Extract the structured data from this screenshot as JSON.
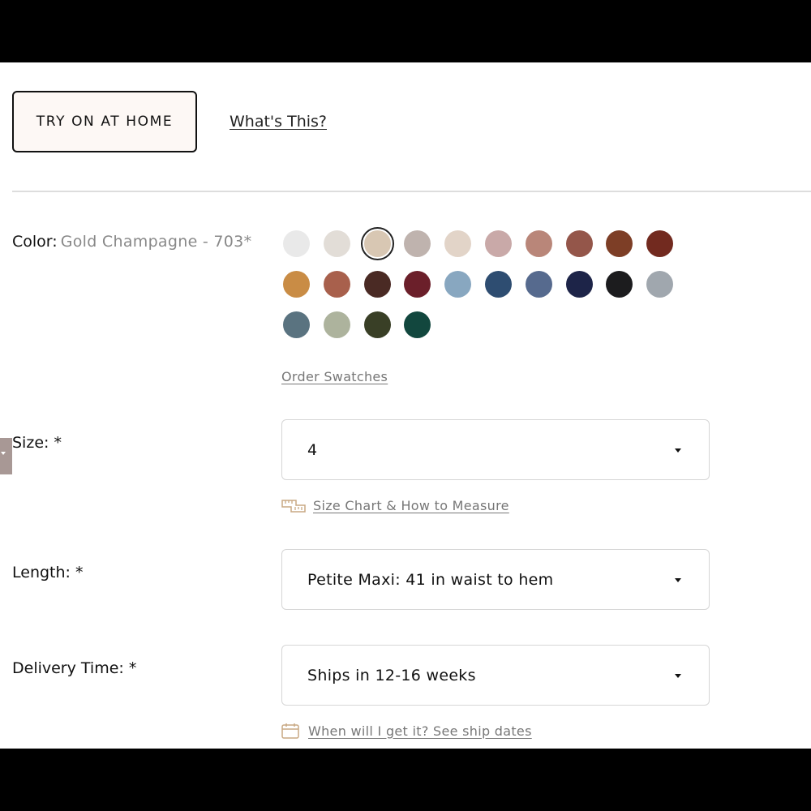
{
  "try_on": {
    "label": "TRY ON AT HOME",
    "help_link": "What's This?"
  },
  "color": {
    "label": "Color:",
    "selected_name": "Gold Champagne - 703*",
    "swatches": [
      "#e9e9e9",
      "#e2ddd7",
      "#d8c7b3",
      "#bfb3ae",
      "#e2d4c8",
      "#c9a9a8",
      "#b98679",
      "#94564a",
      "#7d3e26",
      "#722a1f",
      "#c98c45",
      "#a8604c",
      "#4a2a24",
      "#6b1f2a",
      "#88a7c0",
      "#2e4d71",
      "#566a8e",
      "#1d2448",
      "#1c1c1e",
      "#a0a7ae",
      "#5a7380",
      "#adb39d",
      "#393f26",
      "#12473e"
    ],
    "selected_index": 2,
    "order_swatches": "Order Swatches"
  },
  "size": {
    "label": "Size: *",
    "value": "4",
    "chart_link": "Size Chart & How to Measure"
  },
  "length": {
    "label": "Length: *",
    "value": "Petite Maxi: 41 in waist to hem"
  },
  "delivery": {
    "label": "Delivery Time: *",
    "value": "Ships in 12-16 weeks",
    "ship_dates_link": "When will I get it? See ship dates"
  },
  "icons": {
    "ruler": "ruler-icon",
    "calendar": "calendar-icon",
    "caret": "chevron-down-icon"
  },
  "colors": {
    "accent_icon": "#c9a983",
    "side_tab": "#a89895"
  }
}
